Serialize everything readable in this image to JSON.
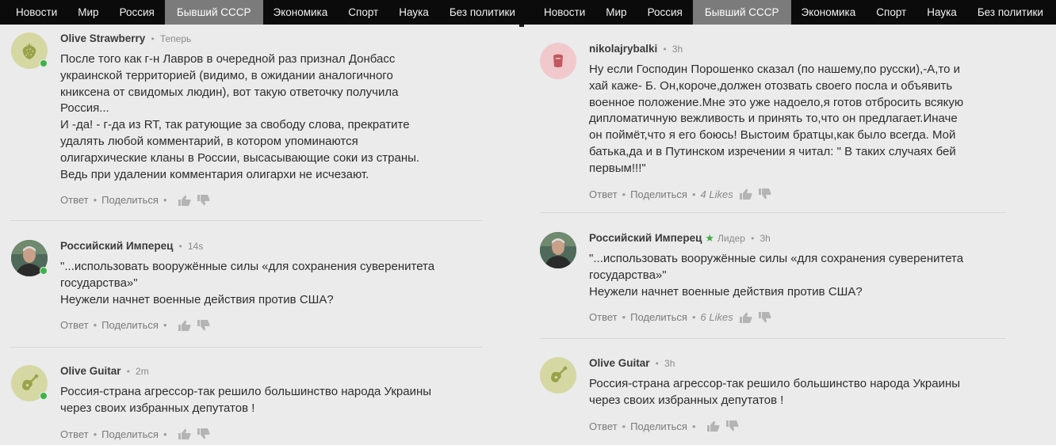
{
  "nav": {
    "items": [
      "Новости",
      "Мир",
      "Россия",
      "Бывший СССР",
      "Экономика",
      "Спорт",
      "Наука",
      "Без политики"
    ],
    "active_index": 3
  },
  "left": {
    "comments": [
      {
        "author": "Olive Strawberry",
        "time": "Теперь",
        "avatar_icon": "strawberry-icon",
        "online": true,
        "text": "После того как г-н Лавров в очередной раз признал Донбасс\nукраинской территорией (видимо, в ожидании аналогичного\nкниксена от свидомых людин), вот такую ответочку получила\nРоссия...\nИ -да! - г-да из RT, так ратующие за свободу слова, прекратите\nудалять любой комментарий, в котором упоминаются\nолигархические кланы в России, высасывающие соки из страны.\nВедь при удалении комментария олигархи не исчезают.",
        "reply": "Ответ",
        "share": "Поделиться"
      },
      {
        "author": "Российский Имперец",
        "time": "14s",
        "avatar_icon": "user-photo",
        "online": true,
        "text": "\"...использовать вооружённые силы «для сохранения суверенитета\nгосударства»\"\nНеужели начнет военные действия против США?",
        "reply": "Ответ",
        "share": "Поделиться"
      },
      {
        "author": "Olive Guitar",
        "time": "2m",
        "avatar_icon": "guitar-icon",
        "online": true,
        "text": "Россия-страна агрессор-так решило большинство народа Украины\nчерез своих избранных депутатов !",
        "reply": "Ответ",
        "share": "Поделиться"
      }
    ]
  },
  "right": {
    "comments": [
      {
        "author": "nikolajrybalki",
        "time": "3h",
        "avatar_icon": "cup-icon",
        "text": "Ну если Господин Порошенко сказал (по нашему,по русски),-А,то и\nхай каже- Б. Он,короче,должен отозвать своего посла и объявить\nвоенное положение.Мне это уже надоело,я готов отбросить всякую\nдипломатичную вежливость и принять то,что он предлагает.Иначе\nон поймёт,что я его боюсь! Выстоим братцы,как было всегда. Мой\nбатька,да и в Путинском изречении я читал: \" В таких случаях бей\nпервым!!!\"",
        "reply": "Ответ",
        "share": "Поделиться",
        "likes": "4 Likes"
      },
      {
        "author": "Российский Имперец",
        "badge": "Лидер",
        "time": "3h",
        "avatar_icon": "user-photo",
        "text": "\"...использовать вооружённые силы «для сохранения суверенитета\nгосударства»\"\nНеужели начнет военные действия против США?",
        "reply": "Ответ",
        "share": "Поделиться",
        "likes": "6 Likes"
      },
      {
        "author": "Olive Guitar",
        "time": "3h",
        "avatar_icon": "guitar-icon",
        "text": "Россия-страна агрессор-так решило большинство народа Украины\nчерез своих избранных депутатов !",
        "reply": "Ответ",
        "share": "Поделиться"
      }
    ]
  },
  "colors": {
    "nav_bg": "#0b0b0b",
    "nav_active": "#7b7b7b",
    "online": "#3bb24a",
    "leader_star": "#3fae3f"
  }
}
